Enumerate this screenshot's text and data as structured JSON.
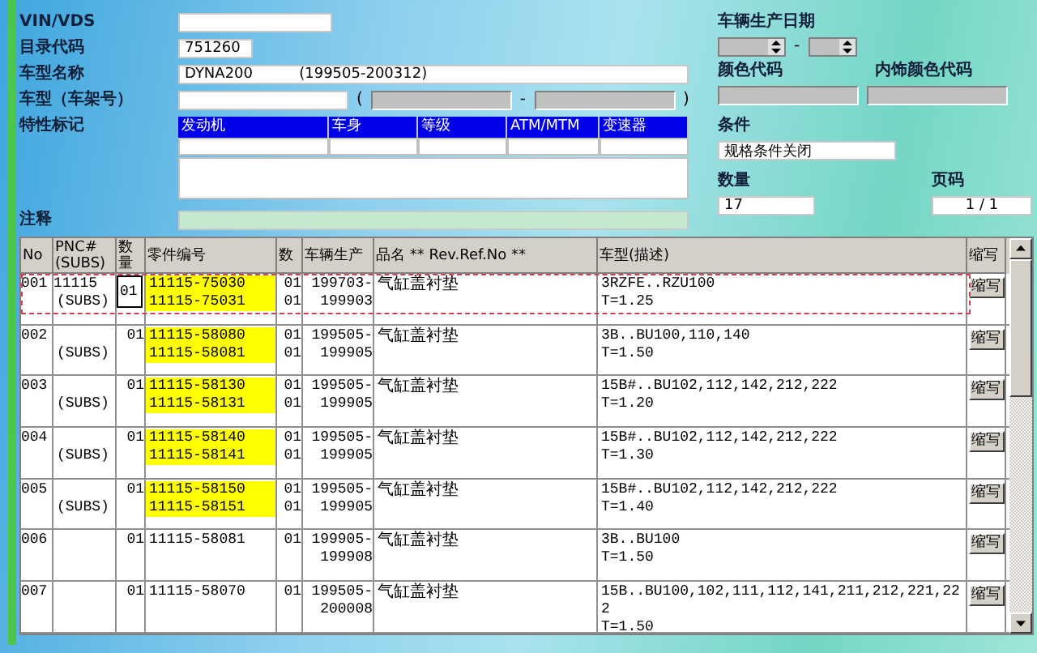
{
  "form": {
    "vin": {
      "label": "VIN/VDS"
    },
    "catalog": {
      "label": "目录代码",
      "value": "751260"
    },
    "model_name": {
      "label": "车型名称",
      "value": "DYNA200          (199505-200312)"
    },
    "frame": {
      "label": "车型（车架号）",
      "open": "(",
      "dash": "-",
      "close": ")"
    },
    "features": {
      "label": "特性标记",
      "columns": [
        "发动机",
        "车身",
        "等级",
        "ATM/MTM",
        "变速器"
      ]
    },
    "note": {
      "label": "注释"
    },
    "production_date": {
      "label": "车辆生产日期",
      "dash": "-"
    },
    "color": {
      "label": "颜色代码"
    },
    "trim_color": {
      "label": "内饰颜色代码"
    },
    "condition": {
      "label": "条件",
      "value": "规格条件关闭"
    },
    "count": {
      "label": "数量",
      "value": "17"
    },
    "page": {
      "label": "页码",
      "value": "1 / 1"
    }
  },
  "table": {
    "columns": [
      "No",
      "PNC# (SUBS)",
      "数量",
      "零件编号",
      "数",
      "车辆生产",
      "品名 ** Rev.Ref.No **",
      "车型(描述)",
      "缩写"
    ],
    "rows": [
      {
        "no": "001",
        "pnc": "11115",
        "subs": "(SUBS)",
        "qty": "01",
        "qty_editable": true,
        "parts": [
          "11115-75030",
          "11115-75031"
        ],
        "highlight": true,
        "counts": [
          "01",
          "01"
        ],
        "dates": [
          "199703-",
          "199903"
        ],
        "name": "气缸盖衬垫",
        "model": [
          "3RZFE..RZU100",
          "T=1.25"
        ],
        "button": "缩写",
        "selected": true
      },
      {
        "no": "002",
        "subs": "(SUBS)",
        "qty": "01",
        "qty_editable": false,
        "parts": [
          "11115-58080",
          "11115-58081"
        ],
        "highlight": true,
        "counts": [
          "01",
          "01"
        ],
        "dates": [
          "199505-",
          "199905"
        ],
        "name": "气缸盖衬垫",
        "model": [
          "3B..BU100,110,140",
          "T=1.50"
        ],
        "button": "缩写",
        "selected": false
      },
      {
        "no": "003",
        "subs": "(SUBS)",
        "qty": "01",
        "qty_editable": false,
        "parts": [
          "11115-58130",
          "11115-58131"
        ],
        "highlight": true,
        "counts": [
          "01",
          "01"
        ],
        "dates": [
          "199505-",
          "199905"
        ],
        "name": "气缸盖衬垫",
        "model": [
          "15B#..BU102,112,142,212,222",
          "T=1.20"
        ],
        "button": "缩写",
        "selected": false
      },
      {
        "no": "004",
        "subs": "(SUBS)",
        "qty": "01",
        "qty_editable": false,
        "parts": [
          "11115-58140",
          "11115-58141"
        ],
        "highlight": true,
        "counts": [
          "01",
          "01"
        ],
        "dates": [
          "199505-",
          "199905"
        ],
        "name": "气缸盖衬垫",
        "model": [
          "15B#..BU102,112,142,212,222",
          "T=1.30"
        ],
        "button": "缩写",
        "selected": false
      },
      {
        "no": "005",
        "subs": "(SUBS)",
        "qty": "01",
        "qty_editable": false,
        "parts": [
          "11115-58150",
          "11115-58151"
        ],
        "highlight": true,
        "counts": [
          "01",
          "01"
        ],
        "dates": [
          "199505-",
          "199905"
        ],
        "name": "气缸盖衬垫",
        "model": [
          "15B#..BU102,112,142,212,222",
          "T=1.40"
        ],
        "button": "缩写",
        "selected": false
      },
      {
        "no": "006",
        "qty": "01",
        "qty_editable": false,
        "parts": [
          "11115-58081"
        ],
        "highlight": false,
        "counts": [
          "01"
        ],
        "dates": [
          "199905-",
          "199908"
        ],
        "name": "气缸盖衬垫",
        "model": [
          "3B..BU100",
          "T=1.50"
        ],
        "button": "缩写",
        "selected": false
      },
      {
        "no": "007",
        "qty": "01",
        "qty_editable": false,
        "parts": [
          "11115-58070"
        ],
        "highlight": false,
        "counts": [
          "01"
        ],
        "dates": [
          "199505-",
          "200008"
        ],
        "name": "气缸盖衬垫",
        "model": [
          "15B..BU100,102,111,112,141,211,212,221,22",
          "2",
          "T=1.50"
        ],
        "button": "缩写",
        "selected": false
      }
    ]
  }
}
